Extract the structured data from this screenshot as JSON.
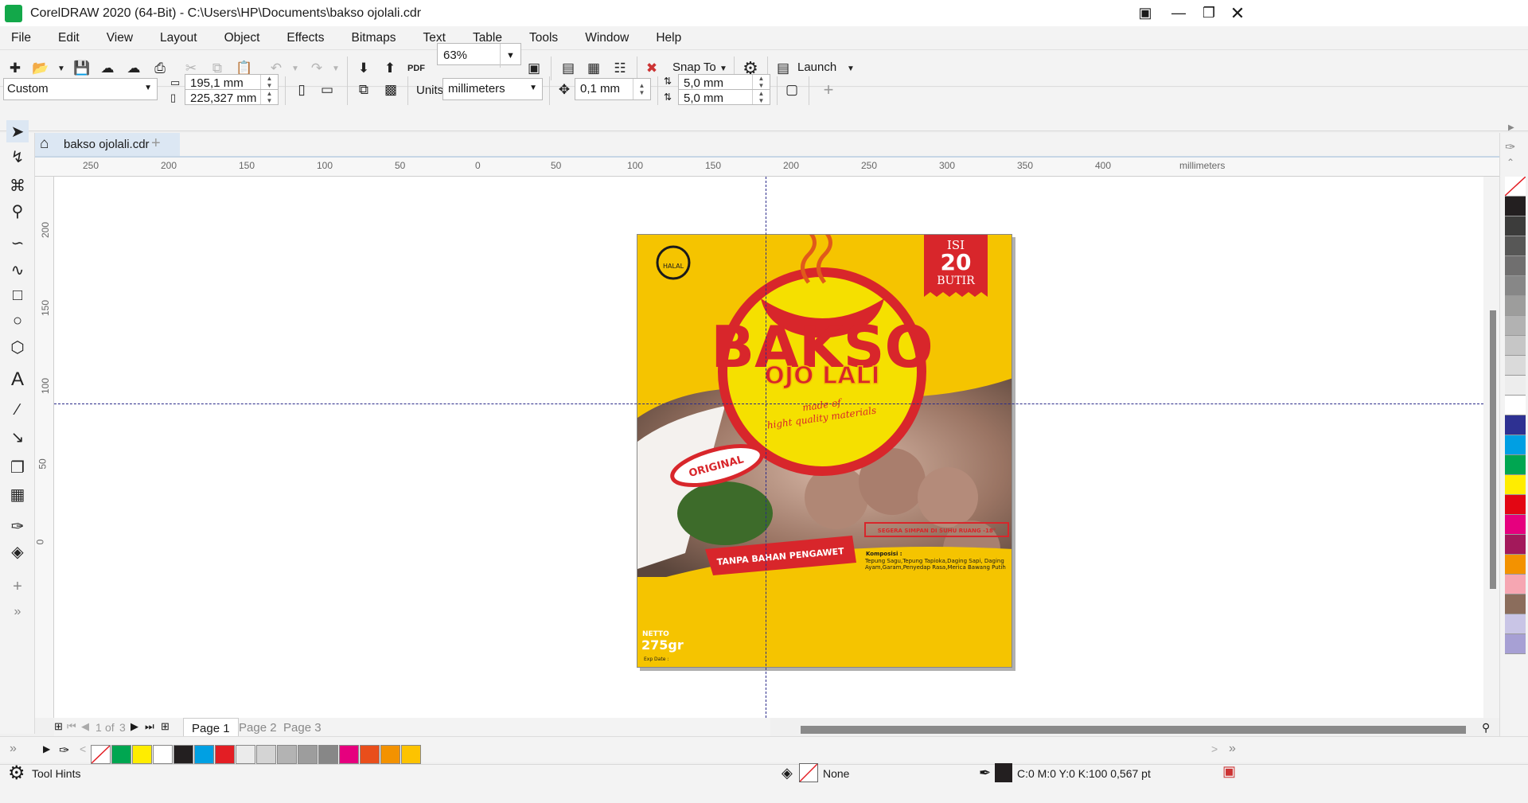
{
  "window": {
    "title": "CorelDRAW 2020 (64-Bit) - C:\\Users\\HP\\Documents\\bakso ojolali.cdr"
  },
  "menu": [
    "File",
    "Edit",
    "View",
    "Layout",
    "Object",
    "Effects",
    "Bitmaps",
    "Text",
    "Table",
    "Tools",
    "Window",
    "Help"
  ],
  "toolbar": {
    "pdf_label": "PDF",
    "zoom": "63%",
    "snap_to": "Snap To",
    "launch": "Launch"
  },
  "property_bar": {
    "page_size": "Custom",
    "width": "195,1 mm",
    "height": "225,327 mm",
    "units_label": "Units:",
    "units": "millimeters",
    "nudge": "0,1 mm",
    "dup_x": "5,0 mm",
    "dup_y": "5,0 mm"
  },
  "document_tab": "bakso ojolali.cdr",
  "ruler_h": {
    "labels": [
      "250",
      "200",
      "150",
      "100",
      "50",
      "0",
      "50",
      "100",
      "150",
      "200",
      "250",
      "300",
      "350",
      "400"
    ],
    "unit": "millimeters"
  },
  "ruler_v": {
    "labels": [
      "200",
      "150",
      "100",
      "50",
      "0"
    ]
  },
  "label_design": {
    "halal": "HALAL",
    "isi": "ISI",
    "count": "20",
    "butir": "BUTIR",
    "brand_line1": "BAKSO",
    "brand_line2": "OJO LALI",
    "tagline1": "made of",
    "tagline2": "hight quality materials",
    "badge": "ORIGINAL",
    "storage": "SEGERA SIMPAN DI SUHU RUANG -18°",
    "no_preservative": "TANPA BAHAN PENGAWET",
    "composition_title": "Komposisi :",
    "composition_text": "Tepung Sagu,Tepung Tapioka,Daging Sapi, Daging Ayam,Garam,Penyedap Rasa,Merica Bawang Putih",
    "netto_label": "NETTO",
    "netto_value": "275gr",
    "exp_label": "Exp Date :"
  },
  "page_nav": {
    "current": "1",
    "of": "of",
    "total": "3",
    "pages": [
      "Page 1",
      "Page 2",
      "Page 3"
    ]
  },
  "status": {
    "tool_hints": "Tool Hints",
    "fill": "None",
    "outline": "C:0 M:0 Y:0 K:100  0,567 pt"
  },
  "colors": {
    "accent": "#13a84a",
    "label_yellow": "#f5c400",
    "label_red": "#d8262b"
  },
  "bottom_palette": [
    "#00a651",
    "#ffed00",
    "#ffffff",
    "#231f20",
    "#00a0e3",
    "#e31e24",
    "#ebebeb",
    "#d4d4d4",
    "#b3b3b3",
    "#9d9d9d",
    "#878787",
    "#e6007e",
    "#e94e1b",
    "#f39200",
    "#fdc300"
  ],
  "right_palette": [
    "#231f20",
    "#3c3c3b",
    "#575756",
    "#706f6f",
    "#878787",
    "#9d9d9c",
    "#b2b2b2",
    "#c6c6c6",
    "#dadada",
    "#ededed",
    "#ffffff",
    "#2e3192",
    "#009fe3",
    "#00a651",
    "#ffed00",
    "#e30613",
    "#e6007e",
    "#a3195b",
    "#f39200",
    "#f6a6b2",
    "#8b6d5c",
    "#c9c5e6",
    "#a7a0d4"
  ]
}
